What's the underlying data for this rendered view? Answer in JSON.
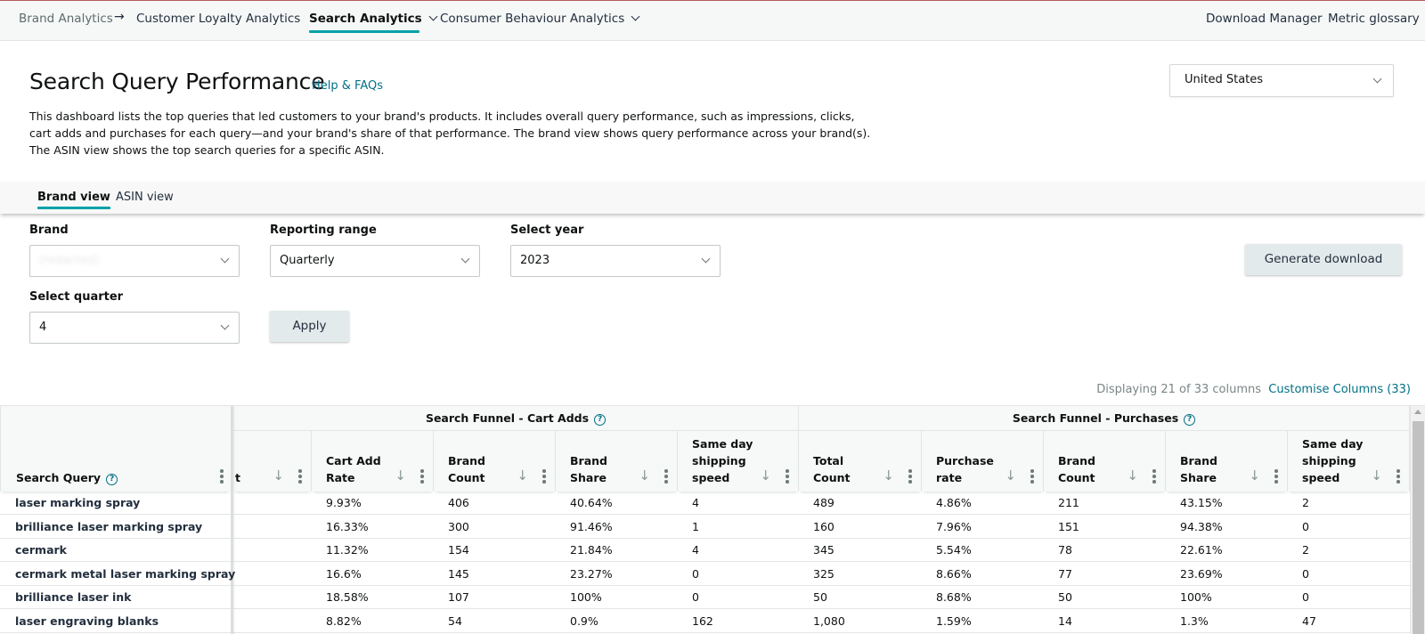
{
  "nav": {
    "breadcrumb_root": "Brand Analytics",
    "breadcrumb_arrow": "→",
    "items": [
      {
        "label": "Customer Loyalty Analytics"
      },
      {
        "label": "Search Analytics"
      },
      {
        "label": "Consumer Behaviour Analytics"
      }
    ],
    "right_links": [
      {
        "label": "Download Manager"
      },
      {
        "label": "Metric glossary"
      }
    ],
    "accent_color": "#00a1a8"
  },
  "header": {
    "title": "Search Query Performance",
    "help_link": "Help & FAQs",
    "description": "This dashboard lists the top queries that led customers to your brand's products. It includes overall query performance, such as impressions, clicks, cart adds and purchases for each query—and your brand's share of that performance. The brand view shows query performance across your brand(s). The ASIN view shows the top search queries for a specific ASIN.",
    "marketplace": "United States"
  },
  "tabs": [
    {
      "label": "Brand view",
      "active": true
    },
    {
      "label": "ASIN view",
      "active": false
    }
  ],
  "filters": {
    "brand": {
      "label": "Brand",
      "value": "(redacted)"
    },
    "reporting_range": {
      "label": "Reporting range",
      "value": "Quarterly"
    },
    "year": {
      "label": "Select year",
      "value": "2023"
    },
    "quarter": {
      "label": "Select quarter",
      "value": "4"
    },
    "apply_label": "Apply",
    "generate_label": "Generate download"
  },
  "columns_info": {
    "displaying": "Displaying 21 of 33 columns",
    "customise": "Customise Columns (33)"
  },
  "table": {
    "frozen_header": "Search Query",
    "help_glyph": "?",
    "groups": [
      {
        "label": "Search Funnel - Cart Adds"
      },
      {
        "label": "Search Funnel - Purchases"
      }
    ],
    "columns": [
      {
        "label": "t"
      },
      {
        "label": "Cart Add Rate"
      },
      {
        "label": "Brand Count"
      },
      {
        "label": "Brand Share"
      },
      {
        "label": "Same day shipping speed"
      },
      {
        "label": "Total Count"
      },
      {
        "label": "Purchase rate"
      },
      {
        "label": "Brand Count"
      },
      {
        "label": "Brand Share"
      },
      {
        "label": "Same day shipping speed"
      }
    ],
    "sort_glyph": "↓",
    "rows": [
      {
        "query": "laser marking spray",
        "cells": [
          "",
          "9.93%",
          "406",
          "40.64%",
          "4",
          "489",
          "4.86%",
          "211",
          "43.15%",
          "2"
        ]
      },
      {
        "query": "brilliance laser marking spray",
        "cells": [
          "",
          "16.33%",
          "300",
          "91.46%",
          "1",
          "160",
          "7.96%",
          "151",
          "94.38%",
          "0"
        ]
      },
      {
        "query": "cermark",
        "cells": [
          "",
          "11.32%",
          "154",
          "21.84%",
          "4",
          "345",
          "5.54%",
          "78",
          "22.61%",
          "2"
        ]
      },
      {
        "query": "cermark metal laser marking spray",
        "cells": [
          "",
          "16.6%",
          "145",
          "23.27%",
          "0",
          "325",
          "8.66%",
          "77",
          "23.69%",
          "0"
        ]
      },
      {
        "query": "brilliance laser ink",
        "cells": [
          "",
          "18.58%",
          "107",
          "100%",
          "0",
          "50",
          "8.68%",
          "50",
          "100%",
          "0"
        ]
      },
      {
        "query": "laser engraving blanks",
        "cells": [
          "",
          "8.82%",
          "54",
          "0.9%",
          "162",
          "1,080",
          "1.59%",
          "14",
          "1.3%",
          "47"
        ]
      }
    ]
  }
}
